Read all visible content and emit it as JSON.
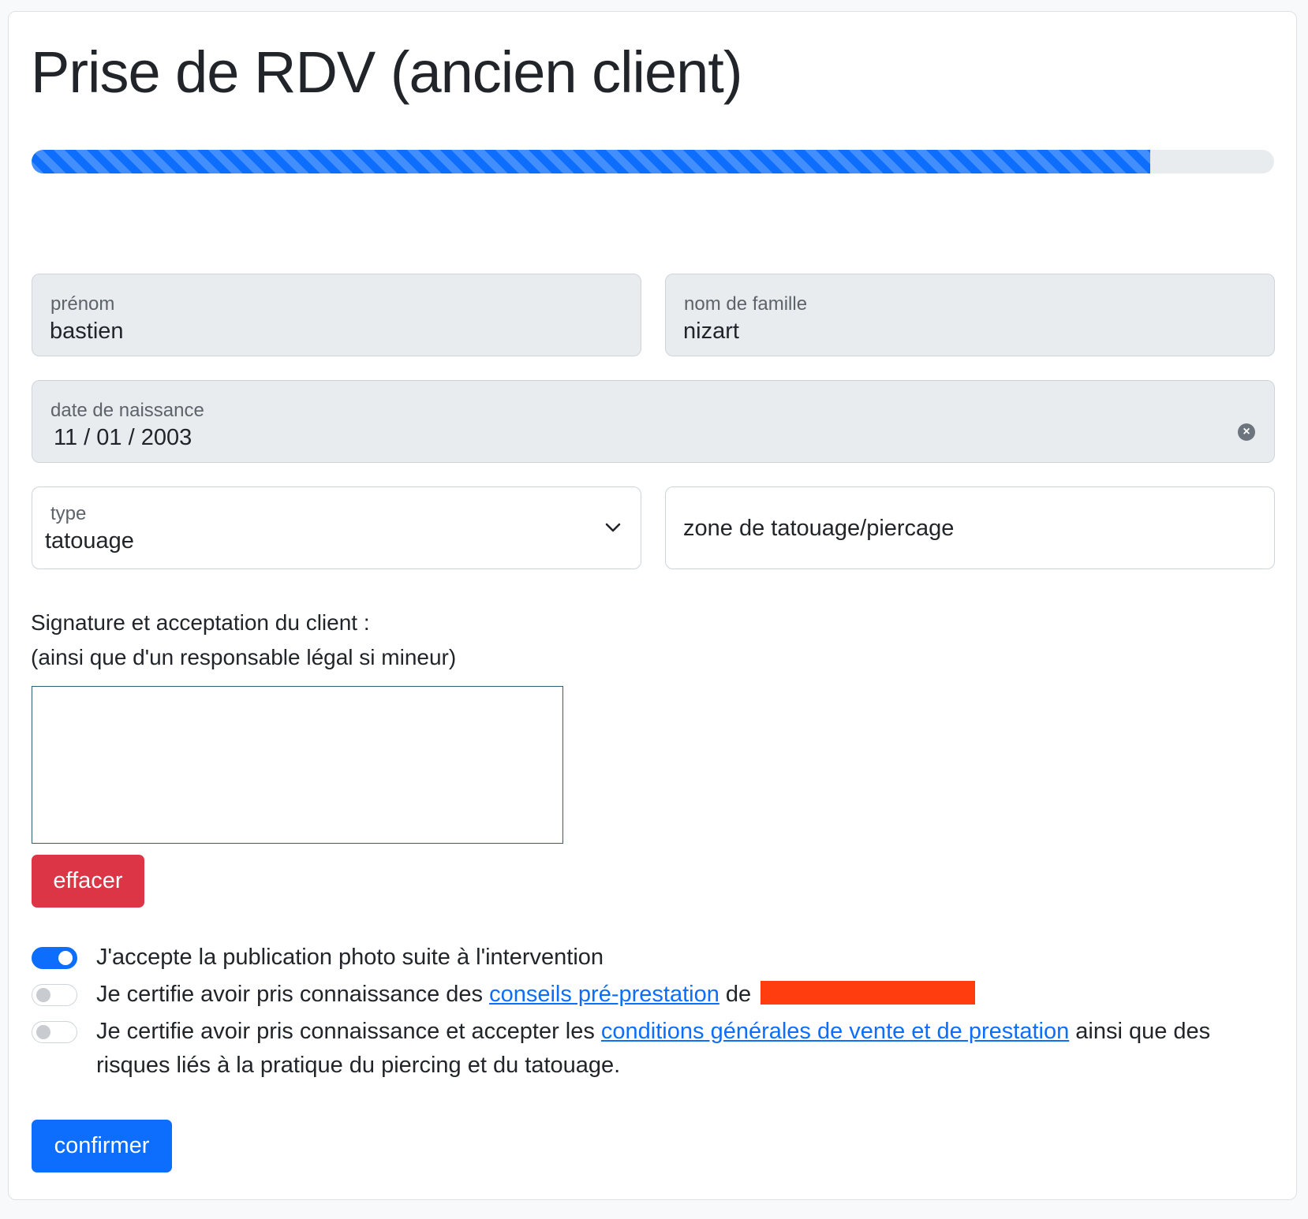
{
  "page": {
    "title": "Prise de RDV (ancien client)",
    "progress_percent": 90
  },
  "form": {
    "first_name": {
      "label": "prénom",
      "value": "bastien"
    },
    "last_name": {
      "label": "nom de famille",
      "value": "nizart"
    },
    "birth_date": {
      "label": "date de naissance",
      "value": "11 / 01 / 2003"
    },
    "type": {
      "label": "type",
      "value": "tatouage"
    },
    "zone": {
      "placeholder": "zone de tatouage/piercage"
    }
  },
  "signature": {
    "line1": "Signature et acceptation du client :",
    "line2": "(ainsi que d'un responsable légal si mineur)",
    "clear_label": "effacer"
  },
  "consents": {
    "photo": {
      "text": "J'accepte la publication photo suite à l'intervention",
      "checked": true
    },
    "advice": {
      "text_before": "Je certifie avoir pris connaissance des ",
      "link": "conseils pré-prestation",
      "text_after": " de",
      "checked": false
    },
    "terms": {
      "text_before": "Je certifie avoir pris connaissance et accepter les ",
      "link": "conditions générales de vente et de prestation",
      "text_after": " ainsi que des risques liés à la pratique du piercing et du tatouage.",
      "checked": false
    }
  },
  "actions": {
    "confirm_label": "confirmer"
  },
  "colors": {
    "primary": "#0d6efd",
    "danger": "#dc3545",
    "redaction": "#ff3d0f"
  },
  "icons": {
    "clear_date": "clear-circle-icon",
    "select": "chevron-down-icon"
  }
}
